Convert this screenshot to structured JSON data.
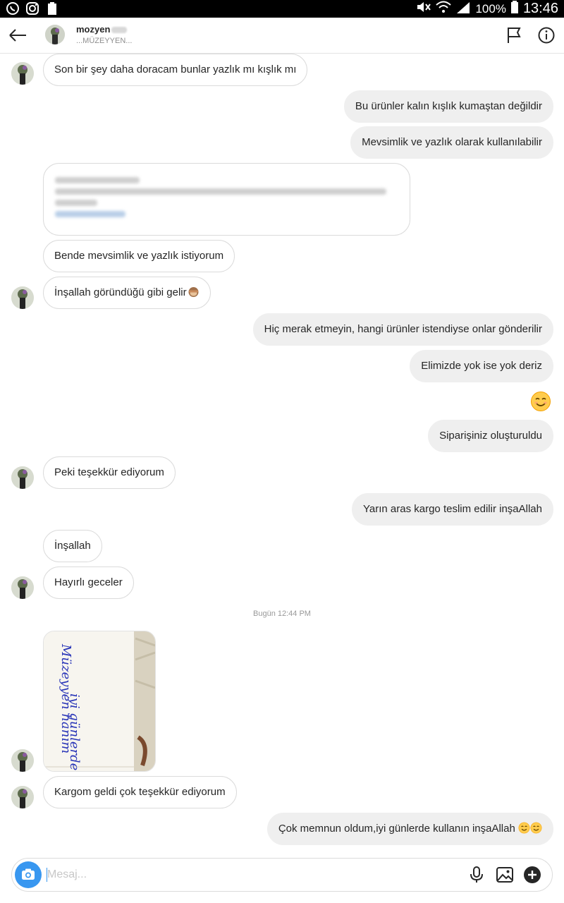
{
  "status_bar": {
    "battery": "100%",
    "time": "13:46"
  },
  "header": {
    "username": "mozyen",
    "subtitle": "...MÜZEYYEN..."
  },
  "messages": {
    "m1": "Son bir şey daha doracam bunlar yazlık mı kışlık mı",
    "m2": "Bu ürünler kalın kışlık kumaştan değildir",
    "m3": "Mevsimlik ve yazlık olarak kullanılabilir",
    "m4": "Bende mevsimlik ve yazlık istiyorum",
    "m5": "İnşallah göründüğü gibi gelir",
    "m6": "Hiç merak etmeyin, hangi ürünler istendiyse onlar gönderilir",
    "m7": "Elimizde yok ise yok deriz",
    "m8": "Siparişiniz oluşturuldu",
    "m9": "Peki teşekkür ediyorum",
    "m10": "Yarın aras kargo teslim edilir inşaAllah",
    "m11": "İnşallah",
    "m12": "Hayırlı geceler",
    "m13": "Kargom geldi çok teşekkür ediyorum",
    "m14": "Çok memnun oldum,iyi günlerde kullanın inşaAllah"
  },
  "timestamp": "Bugün 12:44 PM",
  "photo_text": {
    "line1": "iyi günlerde kullanın",
    "line2": "Müzeyyen hanım"
  },
  "input": {
    "placeholder": "Mesaj..."
  },
  "colors": {
    "accent": "#3897f0",
    "outgoing_bubble": "#efefef",
    "incoming_border": "#dbdbdb"
  }
}
